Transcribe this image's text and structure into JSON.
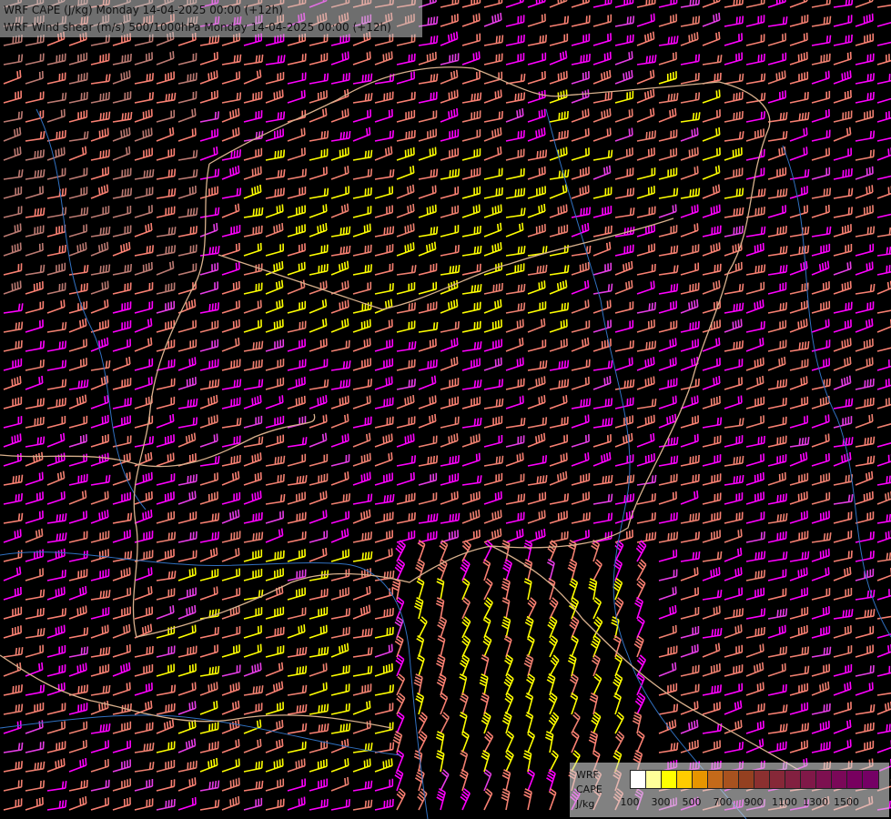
{
  "header": {
    "line1": "WRF CAPE (J/kg) Monday 14-04-2025 00:00 (+12h)",
    "line2": "WRF Wind shear (m/s) 500/1000hPa Monday 14-04-2025 00:00 (+12h)"
  },
  "legend": {
    "label1": "WRF",
    "label2": "CAPE",
    "label3": "J/kg",
    "swatch_colors": [
      "#ffffff",
      "#ffff99",
      "#ffff00",
      "#ffcc00",
      "#e69500",
      "#c46a1a",
      "#a8521f",
      "#944020",
      "#8b3030",
      "#862838",
      "#822040",
      "#801848",
      "#7d1050",
      "#7a0858",
      "#78005f",
      "#750065"
    ],
    "ticks": [
      "100",
      "300",
      "500",
      "700",
      "900",
      "1100",
      "1300",
      "1500"
    ]
  },
  "barb_palette": {
    "colors": [
      "#ff00ff",
      "#e63ce6",
      "#fa8072",
      "#f08070",
      "#bc7a72",
      "#ffff00"
    ]
  },
  "map_colors": {
    "border": "#d8b08c",
    "river": "#3070c0"
  }
}
